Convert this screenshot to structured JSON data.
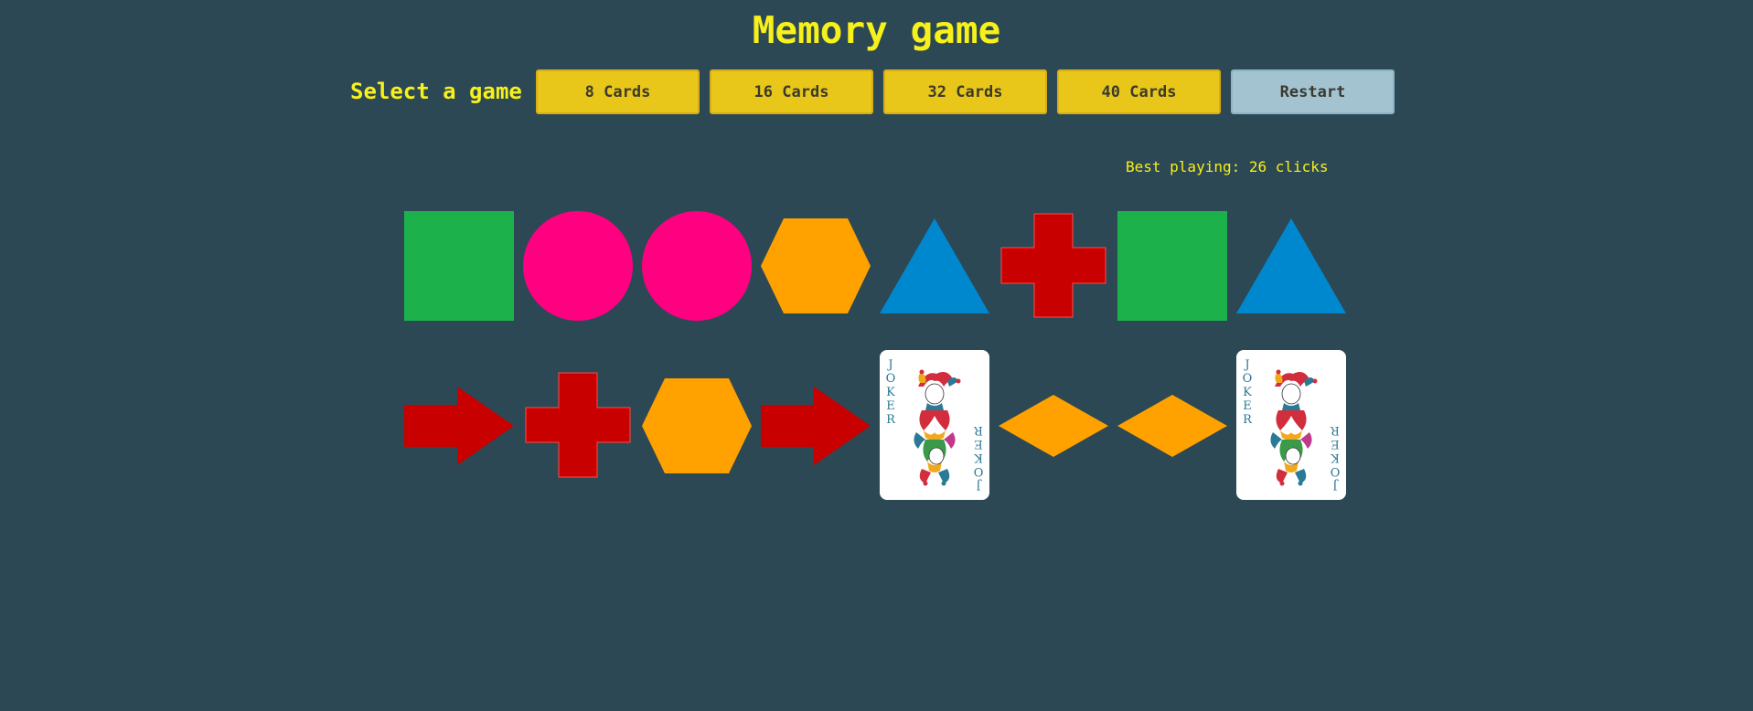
{
  "title": "Memory game",
  "controls": {
    "select_label": "Select a game",
    "buttons": [
      "8 Cards",
      "16 Cards",
      "32 Cards",
      "40 Cards"
    ],
    "restart_label": "Restart"
  },
  "best_playing": "Best playing: 26 clicks",
  "colors": {
    "background": "#2c4854",
    "title": "#f7f01a",
    "button": "#e8c61a",
    "restart_button": "#a3c3d1",
    "green": "#1db14b",
    "pink": "#ff0081",
    "orange": "#ffa200",
    "blue": "#0088cf",
    "red": "#c80000"
  },
  "board": {
    "rows": [
      [
        "green-square",
        "pink-circle",
        "pink-circle",
        "orange-hexagon",
        "blue-triangle",
        "red-cross",
        "green-square",
        "blue-triangle"
      ],
      [
        "red-arrow",
        "red-cross",
        "orange-hexagon",
        "red-arrow",
        "joker-card",
        "orange-diamond",
        "orange-diamond",
        "joker-card"
      ]
    ],
    "joker_text": "JOKER"
  }
}
